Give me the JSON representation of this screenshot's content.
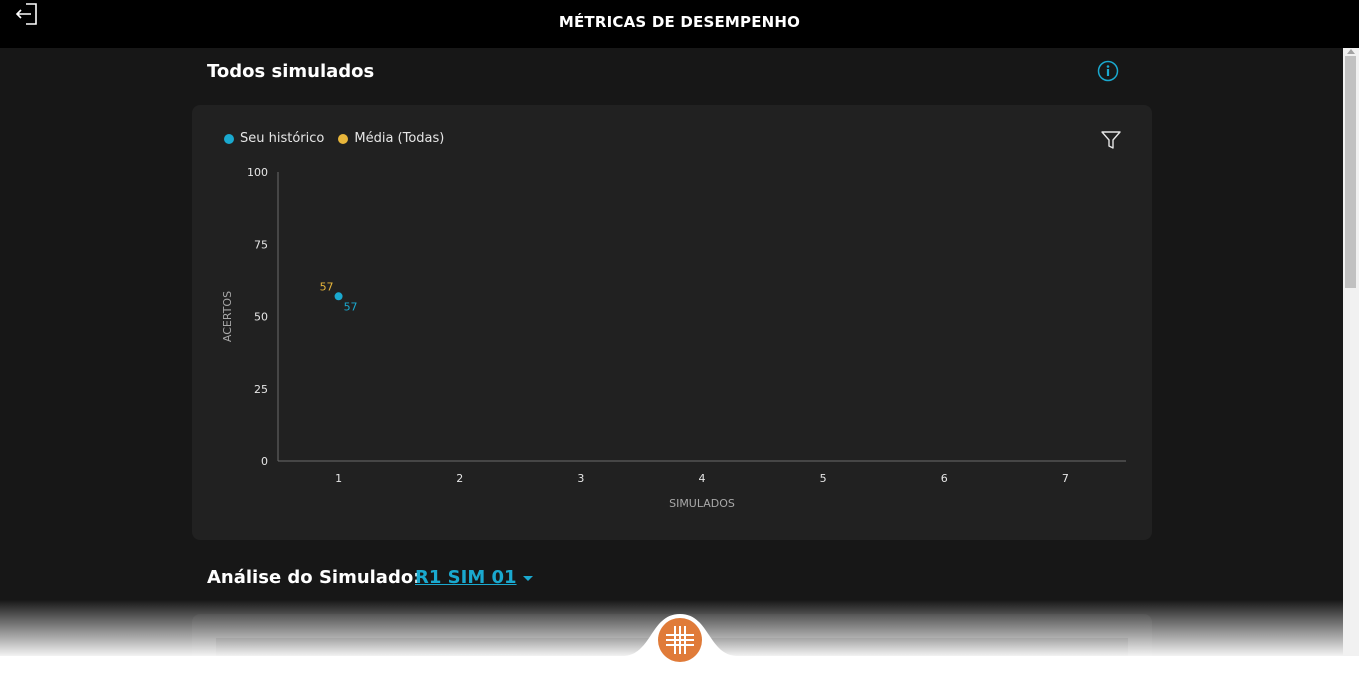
{
  "header": {
    "title": "MÉTRICAS DE DESEMPENHO",
    "back_icon": "logout-arrow-icon"
  },
  "section": {
    "title": "Todos simulados",
    "info_icon": "info-icon"
  },
  "filter_icon": "filter-funnel-icon",
  "chart_data": {
    "type": "scatter",
    "xlabel": "SIMULADOS",
    "ylabel": "ACERTOS",
    "x_ticks": [
      "1",
      "2",
      "3",
      "4",
      "5",
      "6",
      "7"
    ],
    "y_ticks": [
      "0",
      "25",
      "50",
      "75",
      "100"
    ],
    "xlim": [
      0.5,
      7.5
    ],
    "ylim": [
      0,
      100
    ],
    "legend_position": "top-left",
    "grid": false,
    "series": [
      {
        "name": "Seu histórico",
        "color": "#1aa9cf",
        "points": [
          {
            "x": 1,
            "y": 57,
            "label": "57"
          }
        ]
      },
      {
        "name": "Média (Todas)",
        "color": "#e8b63b",
        "points": [
          {
            "x": 1,
            "y": 57,
            "label": "57"
          }
        ]
      }
    ]
  },
  "analysis": {
    "title": "Análise do Simulado:",
    "selected": "R1 SIM 01"
  },
  "logo_icon": "medical-cross-logo-icon",
  "colors": {
    "background": "#171717",
    "card": "#212121",
    "accent_blue": "#1aa9cf",
    "accent_yellow": "#e8b63b",
    "logo_orange": "#e07b39"
  }
}
